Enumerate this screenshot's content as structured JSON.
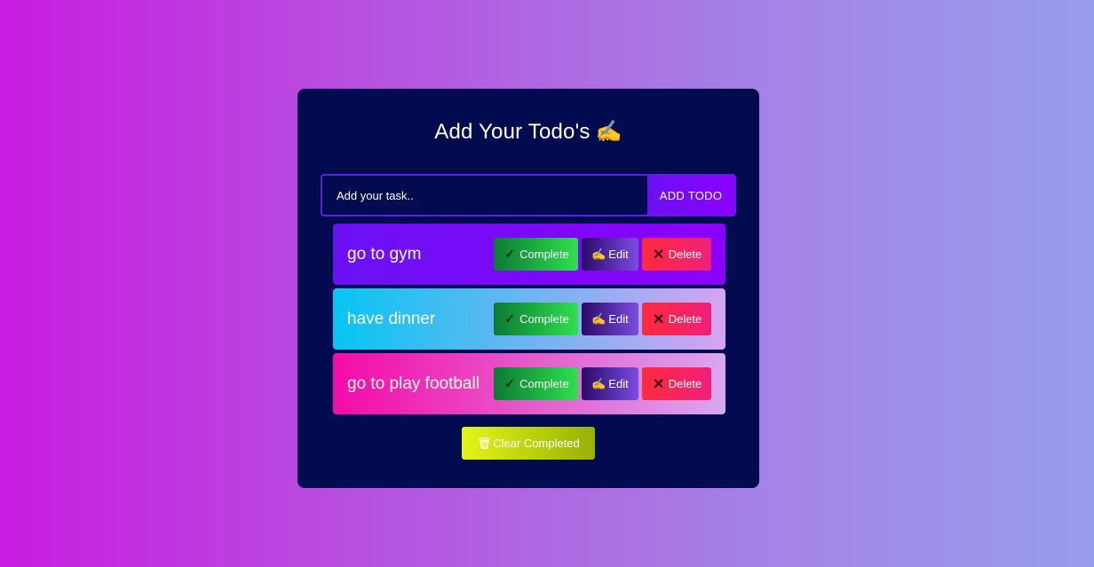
{
  "app": {
    "title": "Add Your Todo's",
    "title_icon": "✍"
  },
  "input": {
    "placeholder": "Add your task..",
    "value": "",
    "add_label": "ADD TODO"
  },
  "todos": [
    {
      "text": "go to gym",
      "background": "linear-gradient(90deg, #6a11f4, #8d00ff)"
    },
    {
      "text": "have dinner",
      "background": "linear-gradient(90deg, #06c6f2, #d6a3f2)"
    },
    {
      "text": "go to play football",
      "background": "linear-gradient(90deg, #f50aa8, #d9a8f0)"
    }
  ],
  "actions": {
    "complete_label": "Complete",
    "complete_icon": "✓",
    "edit_label": "Edit",
    "edit_icon": "✍",
    "delete_label": "Delete",
    "delete_icon": "✕"
  },
  "clear": {
    "label": "Clear Completed",
    "icon": "🗑"
  },
  "colors": {
    "card": "#020b4f",
    "accent": "#6a11f4",
    "complete": "#2fe04d",
    "delete": "#ff2a3d",
    "clear": "#e3f617"
  }
}
